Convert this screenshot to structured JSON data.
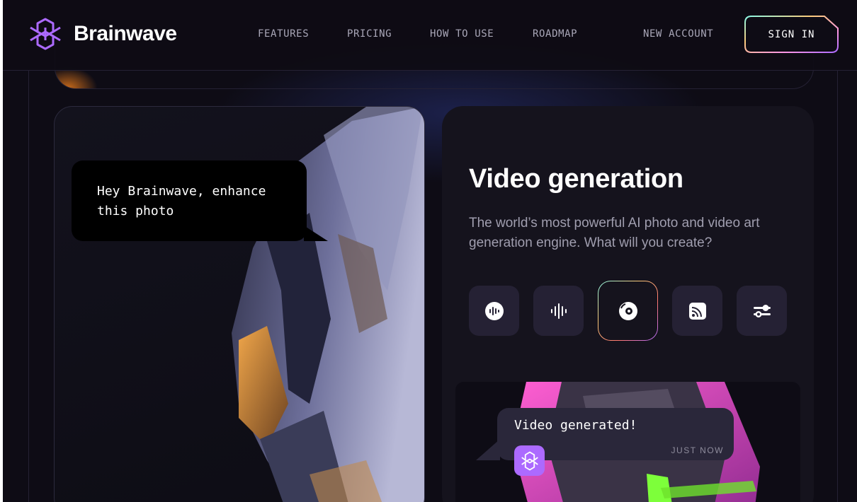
{
  "brand": {
    "name": "Brainwave",
    "accent": "#ac6aff"
  },
  "nav": {
    "items": [
      {
        "label": "FEATURES"
      },
      {
        "label": "PRICING"
      },
      {
        "label": "HOW TO USE"
      },
      {
        "label": "ROADMAP"
      }
    ],
    "new_account": "NEW ACCOUNT",
    "sign_in": "SIGN IN"
  },
  "image_card": {
    "bubble_text": "Hey Brainwave, enhance this photo"
  },
  "panel": {
    "title": "Video generation",
    "description": "The world’s most powerful AI photo and video art generation engine. What will you create?",
    "tools": [
      {
        "icon": "audio-record-icon",
        "active": false
      },
      {
        "icon": "waveform-icon",
        "active": false
      },
      {
        "icon": "video-disc-icon",
        "active": true
      },
      {
        "icon": "cast-icon",
        "active": false
      },
      {
        "icon": "sliders-icon",
        "active": false
      }
    ],
    "chat": {
      "message": "Video generated!",
      "time": "JUST NOW",
      "avatar_icon": "brainwave-logo-icon"
    }
  }
}
